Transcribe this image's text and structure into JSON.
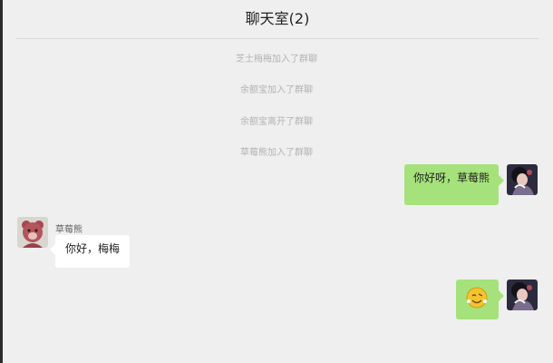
{
  "header": {
    "title": "聊天室(2)"
  },
  "system_messages": [
    "芝士梅梅加入了群聊",
    "余额宝加入了群聊",
    "余额宝离开了群聊",
    "草莓熊加入了群聊"
  ],
  "messages": [
    {
      "side": "right",
      "text": "你好呀，草莓熊"
    },
    {
      "side": "left",
      "sender": "草莓熊",
      "text": "你好，梅梅"
    },
    {
      "side": "right",
      "emoji": "smiley-emoji-icon"
    }
  ],
  "colors": {
    "bubble_self": "#a6e27b",
    "bubble_other": "#ffffff",
    "background": "#efefef",
    "system_text": "#b3b3b3"
  }
}
